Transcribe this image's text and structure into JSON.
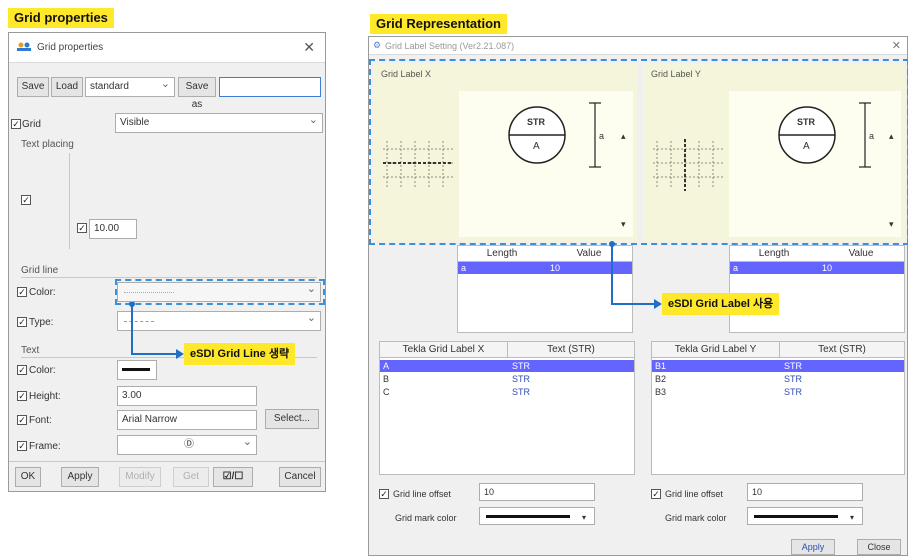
{
  "left_label": "Grid properties",
  "right_label": "Grid Representation",
  "left_dialog": {
    "title": "Grid properties",
    "save": "Save",
    "load": "Load",
    "preset": "standard",
    "save_as": "Save as",
    "grid_label": "Grid",
    "grid_value": "Visible",
    "text_placing": "Text placing",
    "offset_value": "10.00",
    "grid_line_group": "Grid line",
    "color_label": "Color:",
    "type_label": "Type:",
    "text_group": "Text",
    "text_color_label": "Color:",
    "height_label": "Height:",
    "height_value": "3.00",
    "font_label": "Font:",
    "font_value": "Arial Narrow",
    "select_btn": "Select...",
    "frame_label": "Frame:",
    "frame_value": "Ⓓ",
    "ok": "OK",
    "apply": "Apply",
    "modify": "Modify",
    "get": "Get",
    "toggle": "☑/☐",
    "cancel": "Cancel"
  },
  "right_dialog": {
    "title": "Grid Label Setting (Ver2.21.087)",
    "label_x": "Grid Label X",
    "label_y": "Grid Label Y",
    "symbol_top": "STR",
    "symbol_bottom": "A",
    "dim_letter": "a",
    "length_col": "Length",
    "value_col": "Value",
    "x_row": {
      "length": "a",
      "value": "10"
    },
    "y_row": {
      "length": "a",
      "value": "10"
    },
    "tekla_x_header": "Tekla Grid Label X",
    "tekla_y_header": "Tekla Grid Label Y",
    "text_header": "Text (STR)",
    "x_rows": [
      {
        "label": "A",
        "text": "STR"
      },
      {
        "label": "B",
        "text": "STR"
      },
      {
        "label": "C",
        "text": "STR"
      }
    ],
    "y_rows": [
      {
        "label": "B1",
        "text": "STR"
      },
      {
        "label": "B2",
        "text": "STR"
      },
      {
        "label": "B3",
        "text": "STR"
      }
    ],
    "offset_label": "Grid line offset",
    "offset_value": "10",
    "mark_color_label": "Grid mark color",
    "apply": "Apply",
    "close": "Close"
  },
  "callouts": {
    "grid_line": "eSDI Grid Line 생략",
    "grid_label": "eSDI Grid Label 사용"
  },
  "colors": {
    "highlight": "#ffe829",
    "selection": "#6464ff",
    "dashed": "#3f8fd6",
    "panel": "#f5f5dc"
  }
}
